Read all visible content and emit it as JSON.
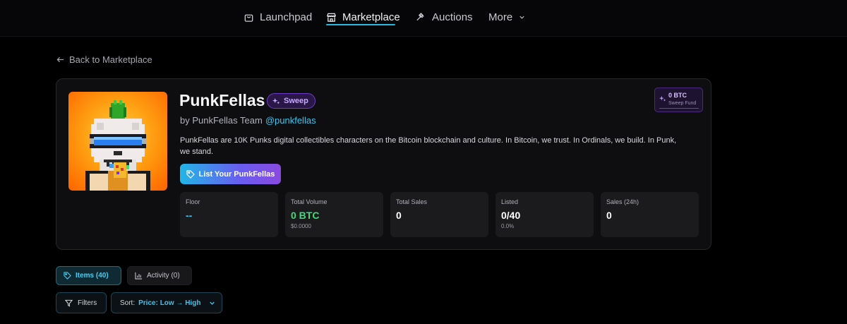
{
  "nav": {
    "items": [
      {
        "label": "Launchpad",
        "icon": "bag-icon"
      },
      {
        "label": "Marketplace",
        "icon": "store-icon"
      },
      {
        "label": "Auctions",
        "icon": "gavel-icon"
      },
      {
        "label": "More",
        "icon": "chevron-down-icon"
      }
    ],
    "active": "Marketplace",
    "accent": "#26b8e0"
  },
  "back_label": "Back to Marketplace",
  "collection": {
    "name": "PunkFellas",
    "badge": "Sweep",
    "by_prefix": "by PunkFellas Team",
    "handle": "@punkfellas",
    "description": "PunkFellas are 10K Punks digital collectibles characters on the Bitcoin blockchain and culture. In Bitcoin, we trust. In Ordinals, we build. In Punk, we stand.",
    "list_button": "List Your PunkFellas"
  },
  "sweep_fund": {
    "value": "0 BTC",
    "label": "Sweep Fund"
  },
  "stats": [
    {
      "label": "Floor",
      "value": "--",
      "sub": ""
    },
    {
      "label": "Total Volume",
      "value": "0 BTC",
      "sub": "$0.0000"
    },
    {
      "label": "Total Sales",
      "value": "0",
      "sub": ""
    },
    {
      "label": "Listed",
      "value": "0/40",
      "sub": "0.0%"
    },
    {
      "label": "Sales (24h)",
      "value": "0",
      "sub": ""
    }
  ],
  "tabs": {
    "items": "Items (40)",
    "activity": "Activity (0)"
  },
  "controls": {
    "filters": "Filters",
    "sort_prefix": "Sort:",
    "sort_value": "Price: Low → High"
  },
  "colors": {
    "background": "#000000",
    "card": "#0e0e10",
    "green": "#3ddc7c",
    "cyan": "#3cc4ec",
    "purple": "#6e3dc7"
  }
}
